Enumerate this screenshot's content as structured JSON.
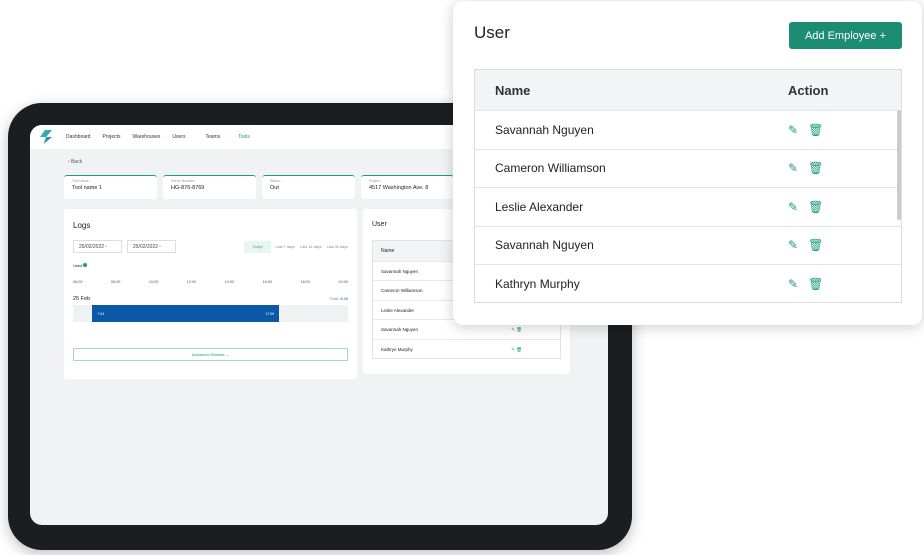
{
  "nav": {
    "items": [
      "Dashboard",
      "Projects",
      "Warehouses",
      "Users",
      "Teams",
      "Tools"
    ],
    "active": "Tools"
  },
  "back": "Back",
  "info": [
    {
      "label": "Tool Name:",
      "value": "Tool name 1"
    },
    {
      "label": "Article Number:",
      "value": "HG-876-8769"
    },
    {
      "label": "Status:",
      "value": "Out"
    },
    {
      "label": "Project:",
      "value": "4517 Washington Ave. 8"
    }
  ],
  "logs": {
    "title": "Logs",
    "date_from": "25/02/2022",
    "date_to": "25/02/2022",
    "filters": [
      "Today",
      "Last 7 days",
      "Last 14 days",
      "Last 30 days"
    ],
    "legend": "Used",
    "times": [
      "06:00",
      "08:00",
      "10:00",
      "12:00",
      "14:00",
      "16:00",
      "18:00",
      "20:00"
    ],
    "day": "25 Feb",
    "total_label": "Total:",
    "total": "8:45",
    "start": "7:04",
    "end": "17:59",
    "advanced": "Advanced Statistic"
  },
  "user_panel": {
    "title": "User",
    "add_button": "Add Employee",
    "col_name": "Name",
    "col_action": "Action",
    "rows": [
      "Savannah Nguyen",
      "Cameron Williamson",
      "Leslie Alexander",
      "Savannah Nguyen",
      "Kathryn Murphy"
    ]
  },
  "colors": {
    "accent": "#1c8c72",
    "bar": "#0b58a8"
  }
}
